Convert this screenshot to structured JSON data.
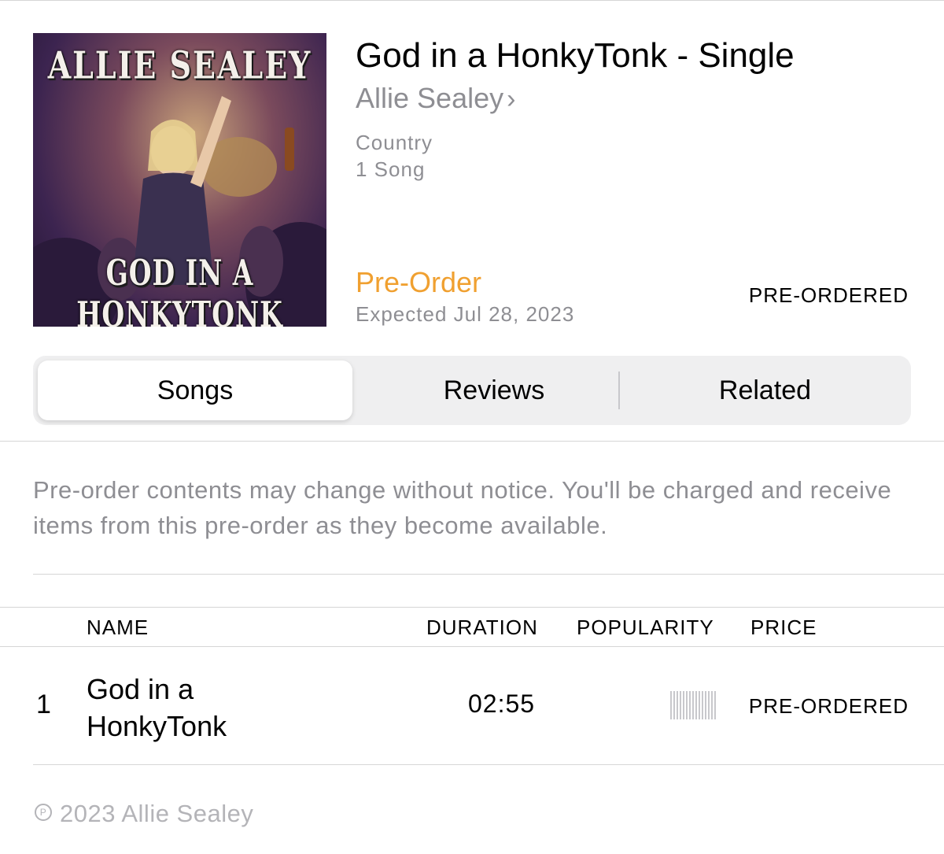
{
  "album": {
    "title": "God in a HonkyTonk - Single",
    "artist": "Allie Sealey",
    "artist_chevron": "›",
    "genre": "Country",
    "song_count": "1 Song",
    "preorder_label": "Pre-Order",
    "expected": "Expected Jul 28, 2023",
    "status": "PRE-ORDERED"
  },
  "artwork": {
    "top_text": "ALLIE SEALEY",
    "bottom_text": "GOD IN A HONKYTONK"
  },
  "tabs": [
    {
      "label": "Songs",
      "selected": true
    },
    {
      "label": "Reviews",
      "selected": false
    },
    {
      "label": "Related",
      "selected": false
    }
  ],
  "notice": "Pre-order contents may change without notice. You'll be charged and receive items from this pre-order as they become available.",
  "table": {
    "headers": {
      "name": "NAME",
      "duration": "DURATION",
      "popularity": "POPULARITY",
      "price": "PRICE"
    },
    "rows": [
      {
        "number": "1",
        "name": "God in a HonkyTonk",
        "duration": "02:55",
        "popularity": 0,
        "price": "PRE-ORDERED"
      }
    ]
  },
  "footer": {
    "copyright_symbol": "P",
    "copyright": "2023 Allie Sealey"
  },
  "colors": {
    "accent_orange": "#f0a030",
    "secondary_gray": "#8e8e93",
    "segment_bg": "#efeff0"
  }
}
